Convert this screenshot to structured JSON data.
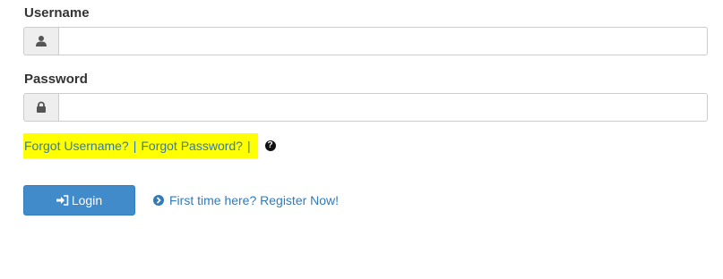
{
  "username": {
    "label": "Username",
    "value": "",
    "icon": "user-icon"
  },
  "password": {
    "label": "Password",
    "value": "",
    "icon": "lock-icon"
  },
  "help_links": {
    "forgot_username": "Forgot Username?",
    "separator_1": "|",
    "forgot_password": "Forgot Password?",
    "separator_2": "|",
    "help_icon": "question-circle-icon",
    "highlight_color": "#ffff00"
  },
  "login_button": {
    "label": "Login",
    "icon": "sign-in-icon",
    "color": "#428bca"
  },
  "register": {
    "label": "First time here? Register Now!",
    "icon": "arrow-circle-right-icon",
    "color": "#337ab7"
  }
}
